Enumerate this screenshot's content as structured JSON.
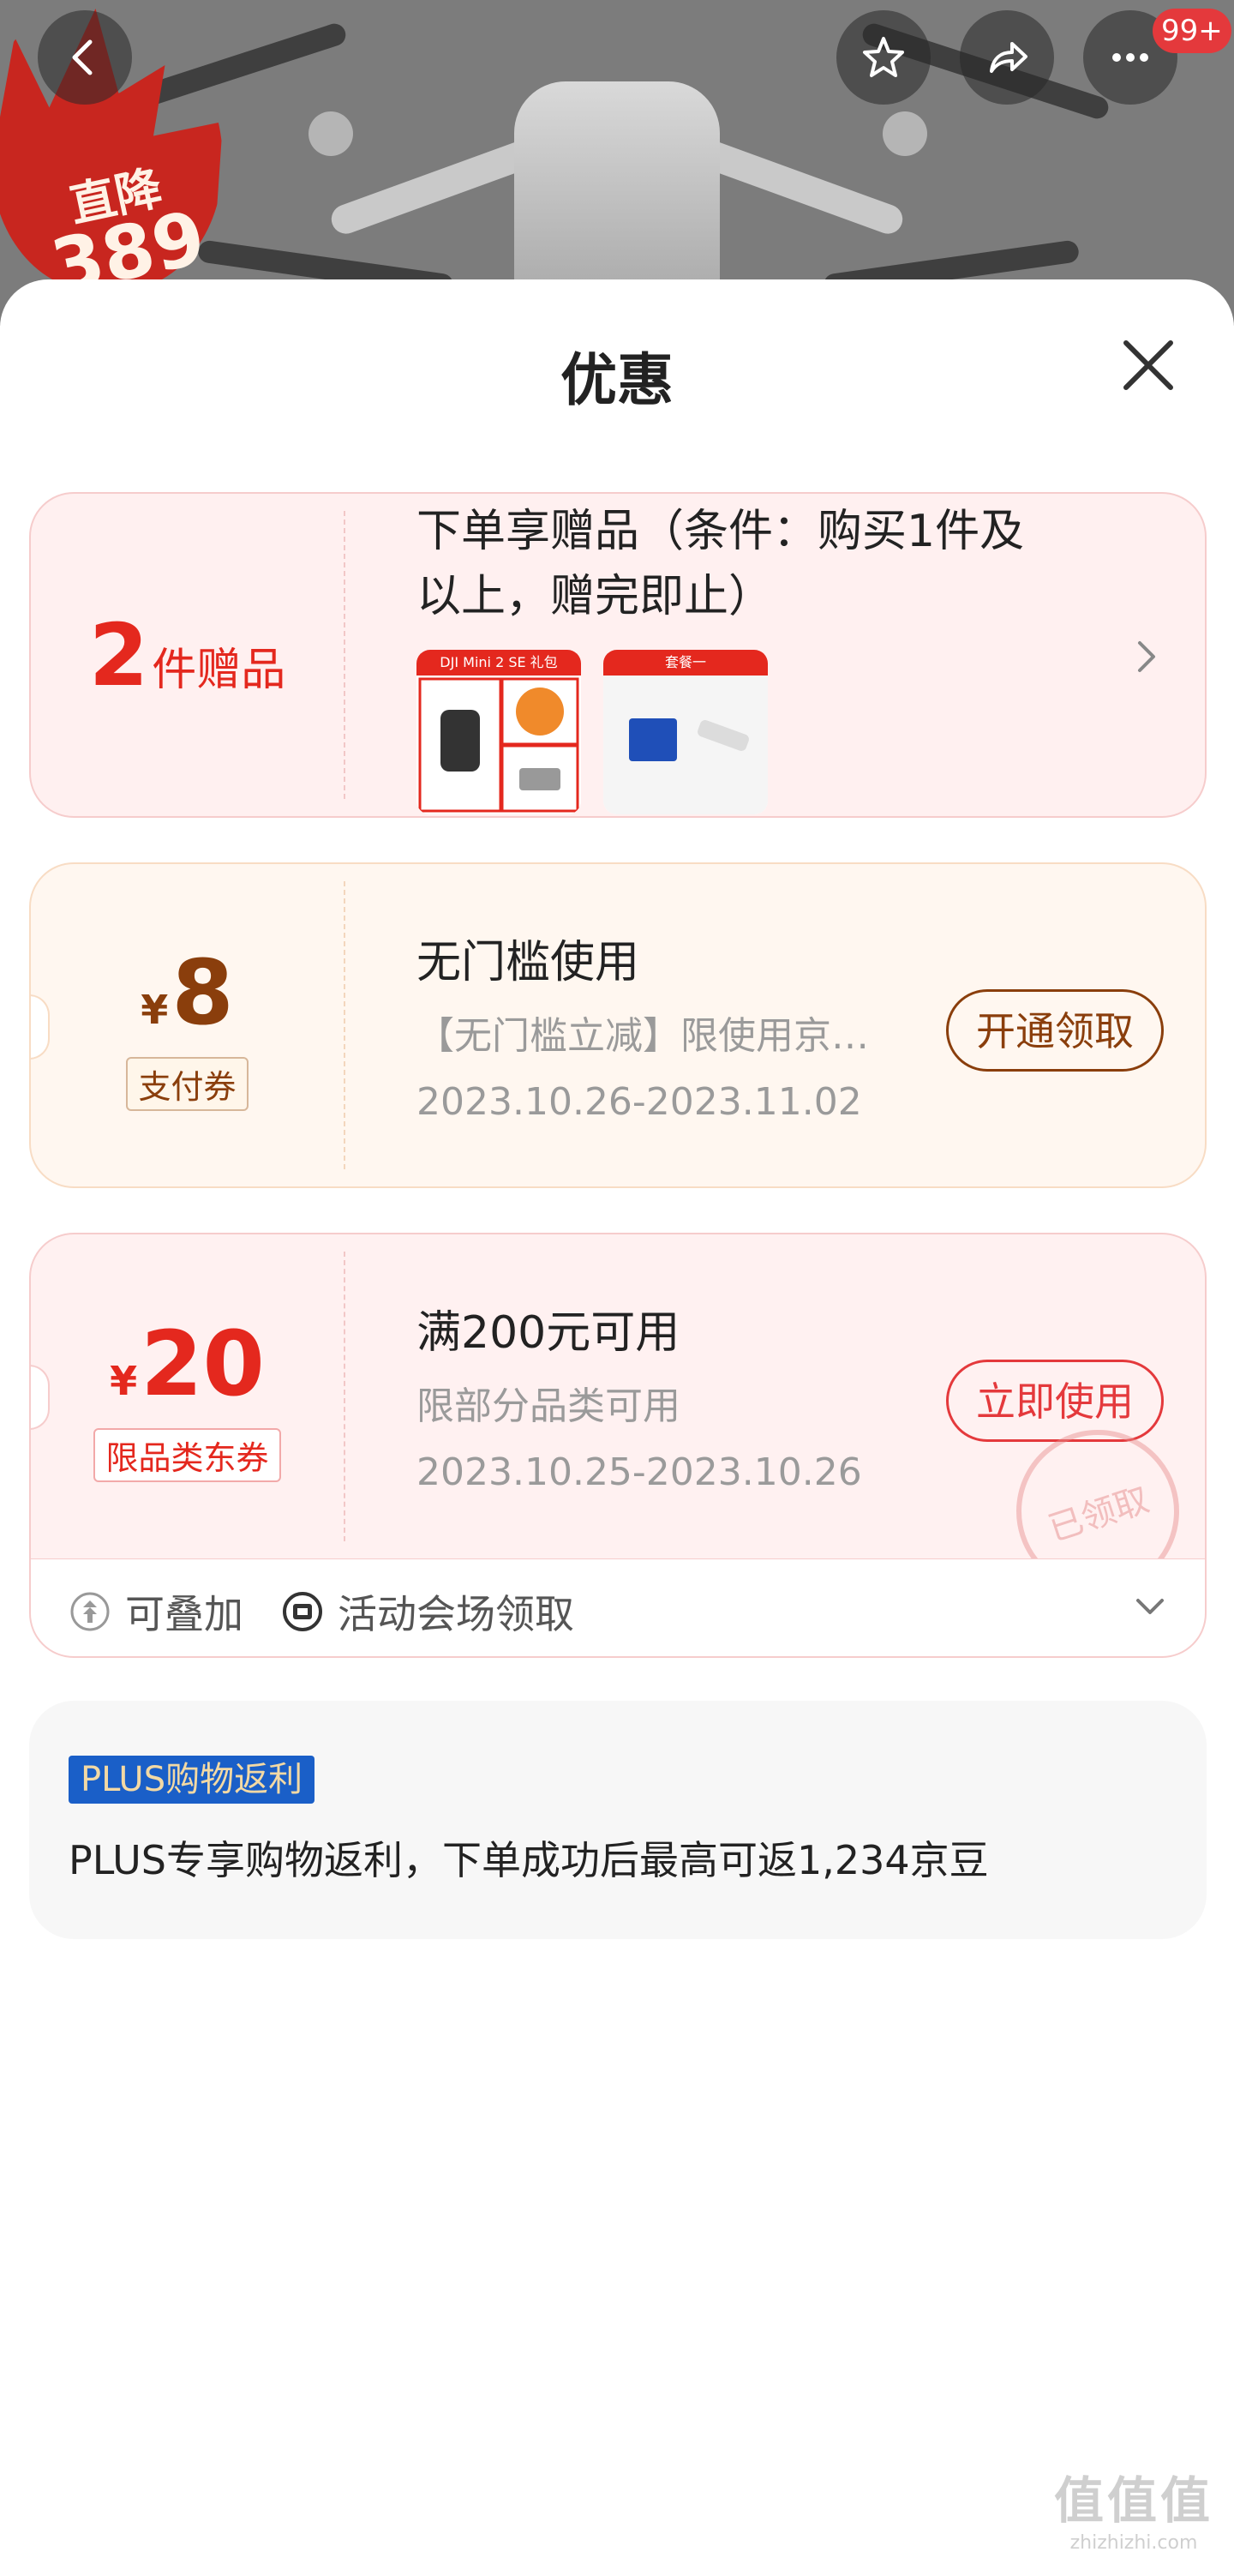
{
  "hero": {
    "promo_line1": "直降",
    "promo_line2": "389",
    "cart_badge": "99+"
  },
  "sheet": {
    "title": "优惠"
  },
  "gift": {
    "count": "2",
    "unit": "件赠品",
    "title": "下单享赠品（条件：购买1件及以上，赠完即止）",
    "images": [
      {
        "label": "DJI Mini 2 SE 礼包"
      },
      {
        "label": "套餐一"
      }
    ]
  },
  "coupon1": {
    "currency": "¥",
    "amount": "8",
    "tag": "支付券",
    "title": "无门槛使用",
    "desc": "【无门槛立减】限使用京…",
    "date": "2023.10.26-2023.11.02",
    "button": "开通领取"
  },
  "coupon2": {
    "currency": "¥",
    "amount": "20",
    "tag": "限品类东券",
    "title": "满200元可用",
    "desc": "限部分品类可用",
    "date": "2023.10.25-2023.10.26",
    "button": "立即使用",
    "stamp": "已领取",
    "foot_stack": "可叠加",
    "foot_source": "活动会场领取"
  },
  "plus": {
    "badge": "PLUS购物返利",
    "text": "PLUS专享购物返利，下单成功后最高可返1,234京豆"
  },
  "watermark": {
    "logo": "值值值",
    "site": "zhizhizhi.com"
  },
  "colors": {
    "accent_red": "#e4281e",
    "coupon_brown": "#8a3e0c",
    "coupon_red": "#e4393c",
    "plus_blue": "#1a5fc8"
  }
}
